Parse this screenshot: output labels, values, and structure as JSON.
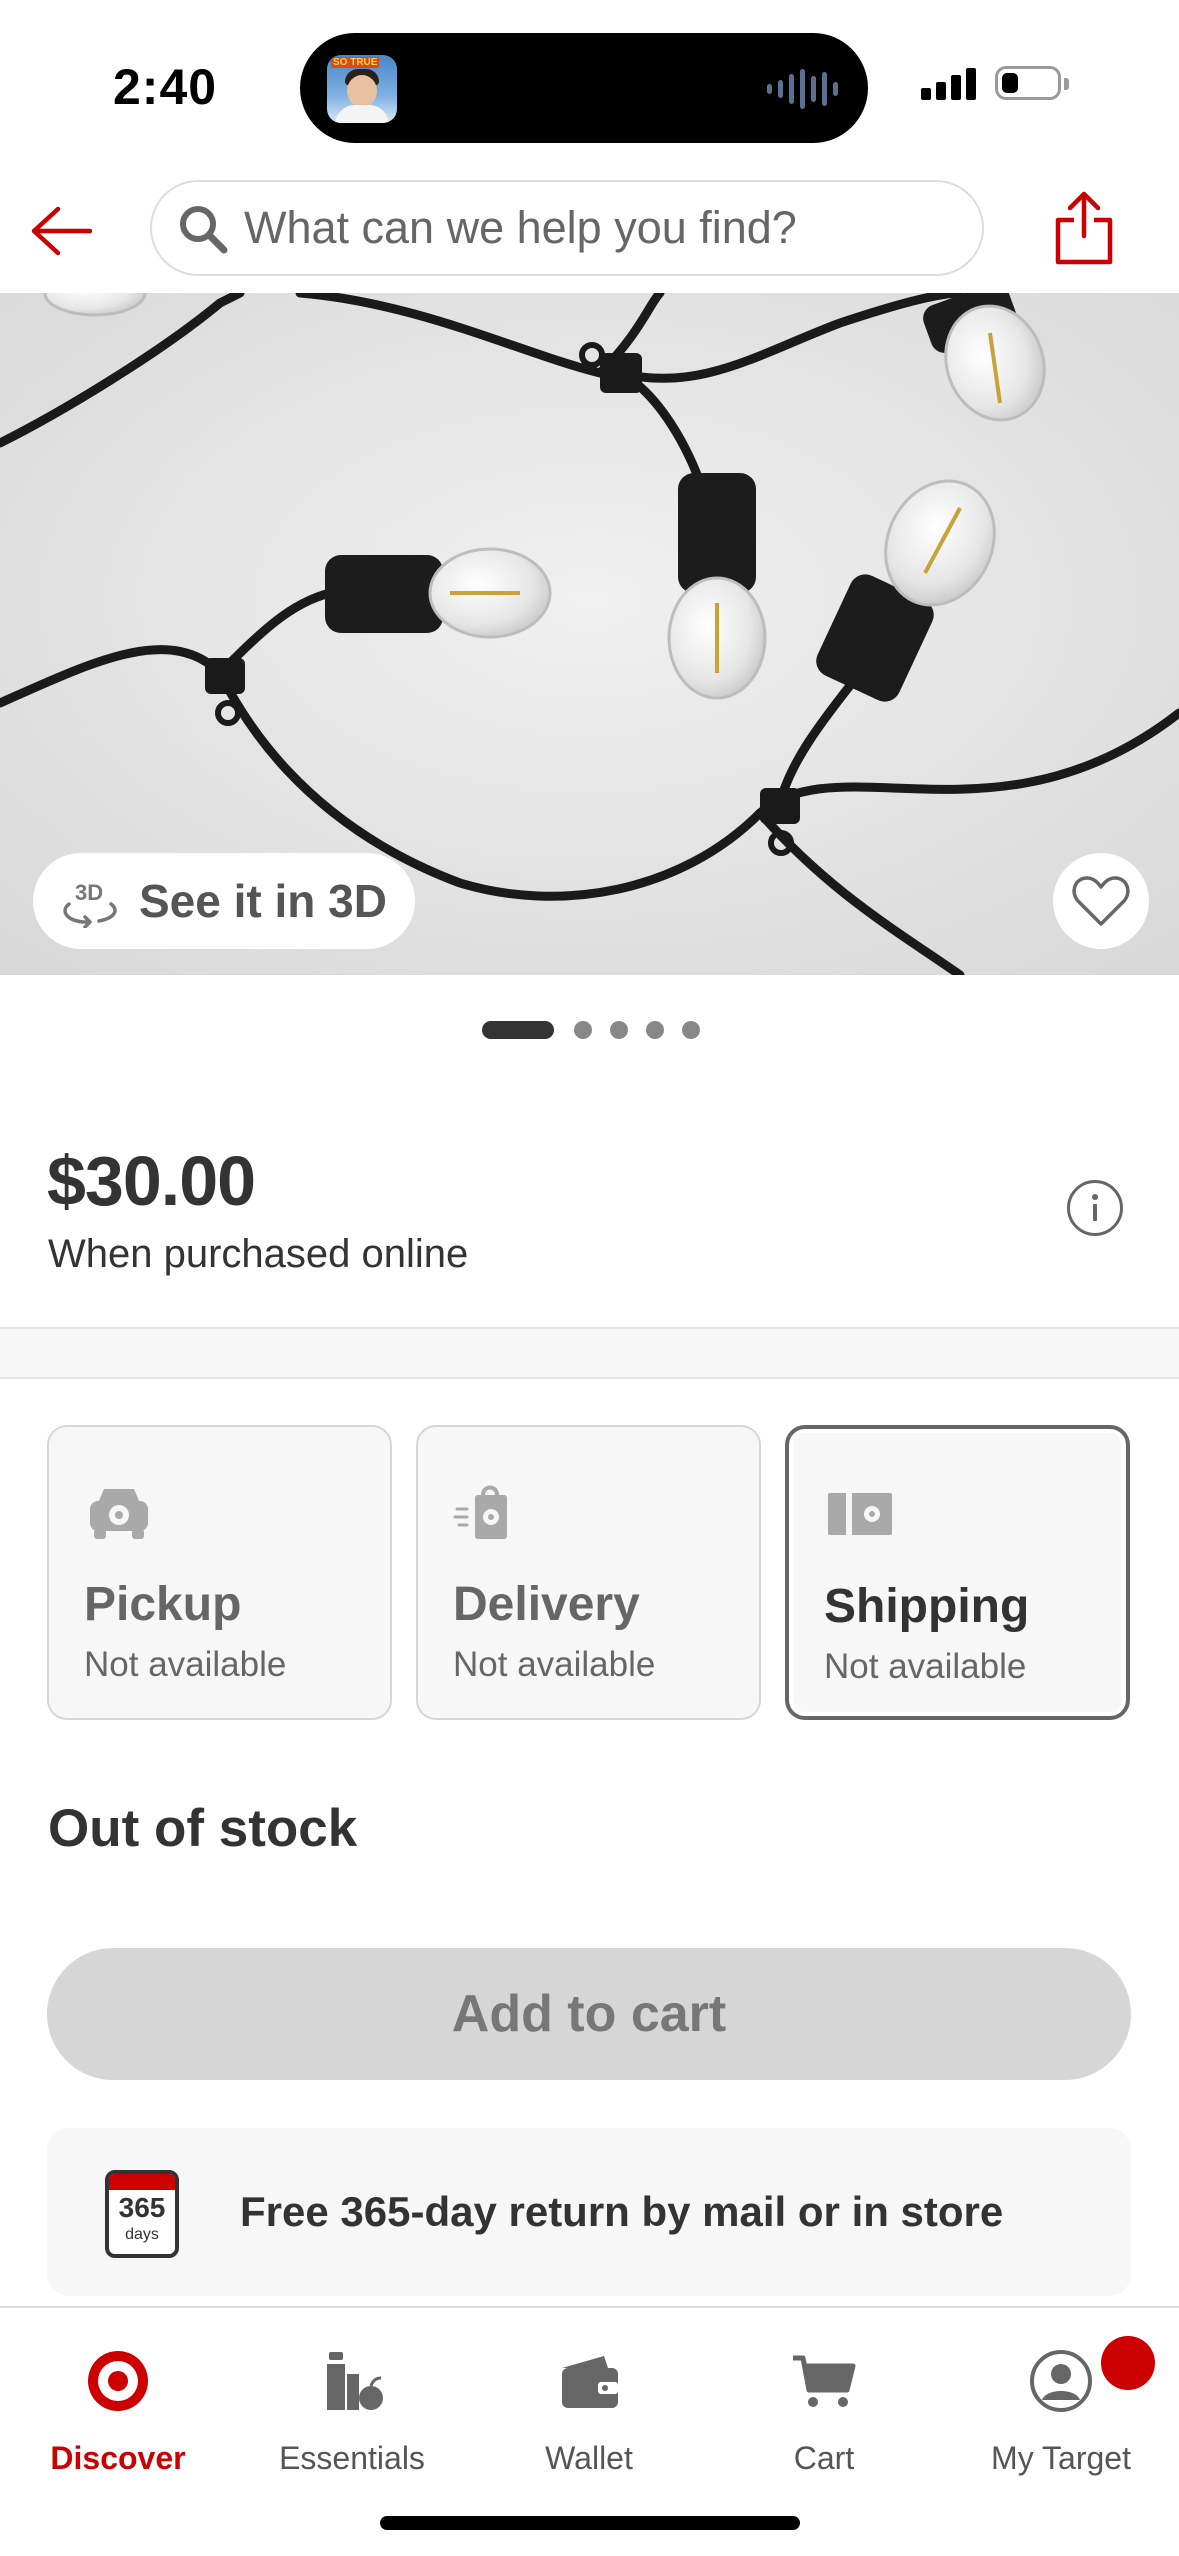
{
  "status_bar": {
    "time": "2:40",
    "dynamic_island_avatar_text": "SO TRUE"
  },
  "header": {
    "back_icon": "arrow-left-icon",
    "search_placeholder": "What can we help you find?",
    "share_icon": "share-icon"
  },
  "hero": {
    "see_in_3d_label": "See it in 3D",
    "favorite_icon": "heart-icon",
    "image_count": 5,
    "active_index": 0
  },
  "price": {
    "amount": "$30.00",
    "subtext": "When purchased online"
  },
  "fulfillment": [
    {
      "title": "Pickup",
      "status": "Not available",
      "icon": "car-icon",
      "selected": false
    },
    {
      "title": "Delivery",
      "status": "Not available",
      "icon": "shopping-bag-icon",
      "selected": false
    },
    {
      "title": "Shipping",
      "status": "Not available",
      "icon": "shipping-box-icon",
      "selected": true
    }
  ],
  "stock_status": "Out of stock",
  "add_to_cart_label": "Add to cart",
  "returns": {
    "badge_number": "365",
    "badge_unit": "days",
    "text": "Free 365-day return by mail or in store"
  },
  "tabs": [
    {
      "label": "Discover",
      "icon": "target-logo-icon",
      "active": true
    },
    {
      "label": "Essentials",
      "icon": "essentials-icon",
      "active": false
    },
    {
      "label": "Wallet",
      "icon": "wallet-icon",
      "active": false
    },
    {
      "label": "Cart",
      "icon": "cart-icon",
      "active": false
    },
    {
      "label": "My Target",
      "icon": "profile-icon",
      "active": false,
      "badge": true
    }
  ],
  "colors": {
    "brand_red": "#cc0000",
    "text_dark": "#333333",
    "text_muted": "#666666",
    "disabled_button": "#d6d6d6"
  }
}
